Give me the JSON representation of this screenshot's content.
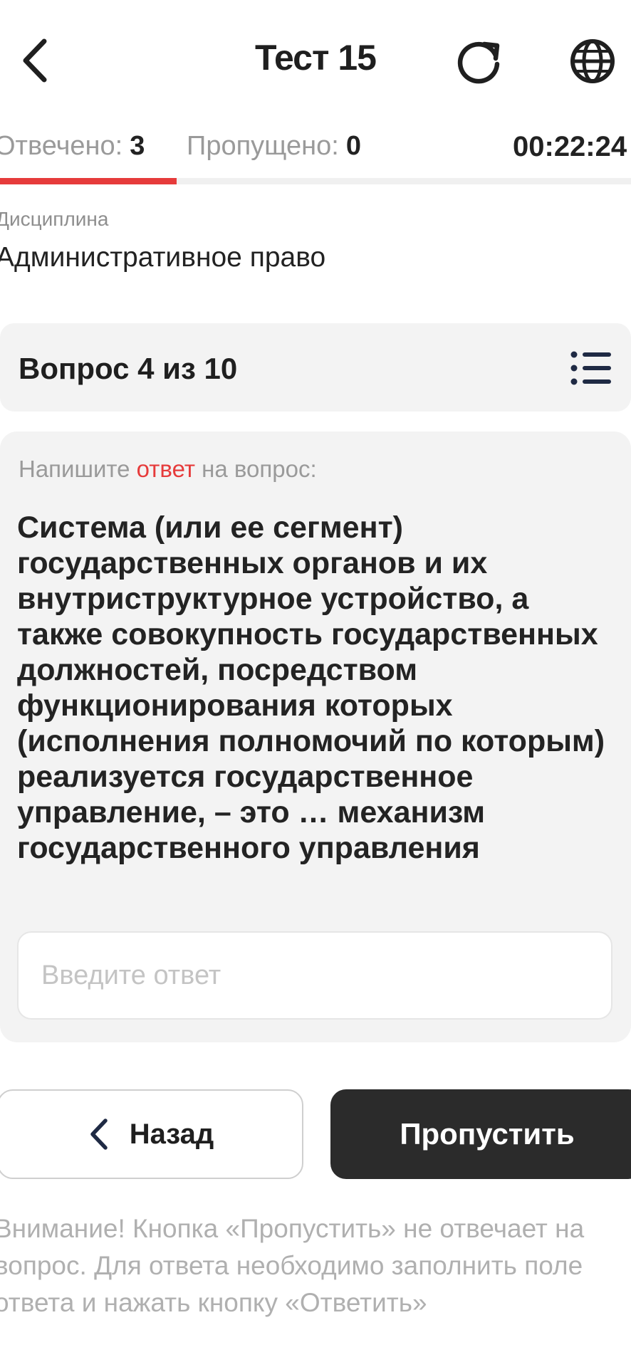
{
  "header": {
    "title": "Тест 15",
    "back_icon": "chevron-left-icon",
    "reload_icon": "reload-icon",
    "language_icon": "globe-icon"
  },
  "progress": {
    "answered_label": "Отвечено:",
    "answered_count": "3",
    "skipped_label": "Пропущено:",
    "skipped_count": "0",
    "timer": "00:22:24",
    "completed_fraction": 0.28,
    "accent_color": "#e63b3b"
  },
  "discipline": {
    "label": "Дисциплина",
    "value": "Административное право"
  },
  "question_counter": {
    "text": "Вопрос 4 из 10",
    "list_icon": "list-icon"
  },
  "question": {
    "prompt_before": "Напишите ",
    "prompt_accent": "ответ",
    "prompt_after": " на вопрос:",
    "text": "Система (или ее сегмент) государственных органов и их внутриструктурное устройство, а также совокупность государственных должностей, посредством функционирования которых (исполнения полномочий по которым) реализуется государственное управление, – это … механизм государственного управления",
    "answer_value": "",
    "answer_placeholder": "Введите ответ"
  },
  "actions": {
    "back_label": "Назад",
    "skip_label": "Пропустить"
  },
  "note": {
    "text": "Внимание! Кнопка «Пропустить» не отвечает на вопрос. Для ответа необходимо заполнить поле ответа и нажать кнопку «Ответить»"
  }
}
